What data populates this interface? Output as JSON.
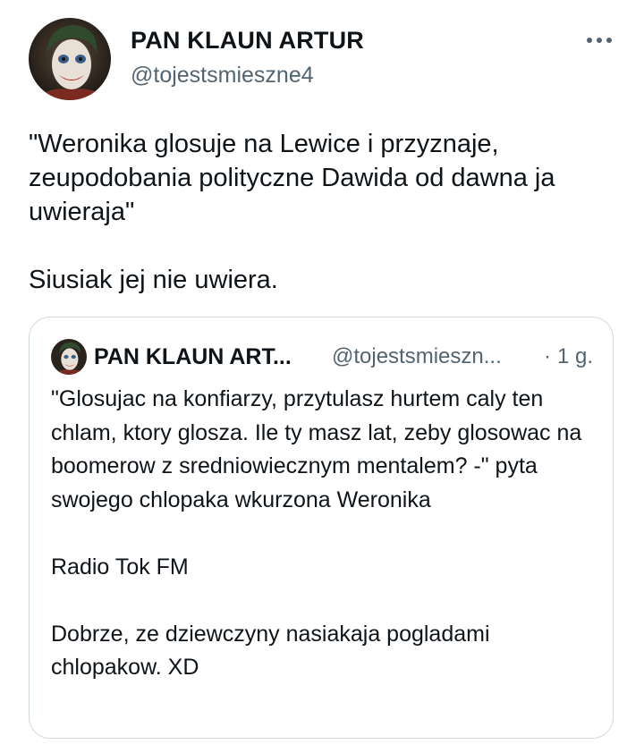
{
  "author": {
    "display_name": "PAN KLAUN ARTUR",
    "handle": "@tojestsmieszne4",
    "avatar_icon": "joker-avatar-icon"
  },
  "more_icon": "more-horizontal-icon",
  "tweet": {
    "paragraph_1": "\"Weronika glosuje na Lewice i przyznaje, zeupodobania polityczne Dawida od dawna ja uwieraja\"",
    "paragraph_2": "Siusiak jej nie uwiera."
  },
  "quote": {
    "display_name": "PAN KLAUN ART...",
    "handle": "@tojestsmieszn...",
    "separator": "·",
    "time": "1 g.",
    "paragraph_1": "\"Glosujac na konfiarzy, przytulasz hurtem caly ten chlam, ktory glosza. Ile ty masz lat, zeby glosowac na boomerow z sredniowiecznym mentalem? -\" pyta swojego chlopaka wkurzona Weronika",
    "paragraph_2": "Radio Tok FM",
    "paragraph_3": "Dobrze, ze dziewczyny nasiakaja pogladami chlopakow. XD"
  },
  "colors": {
    "text": "#0f1419",
    "secondary": "#536471",
    "border": "#cfd9de"
  }
}
